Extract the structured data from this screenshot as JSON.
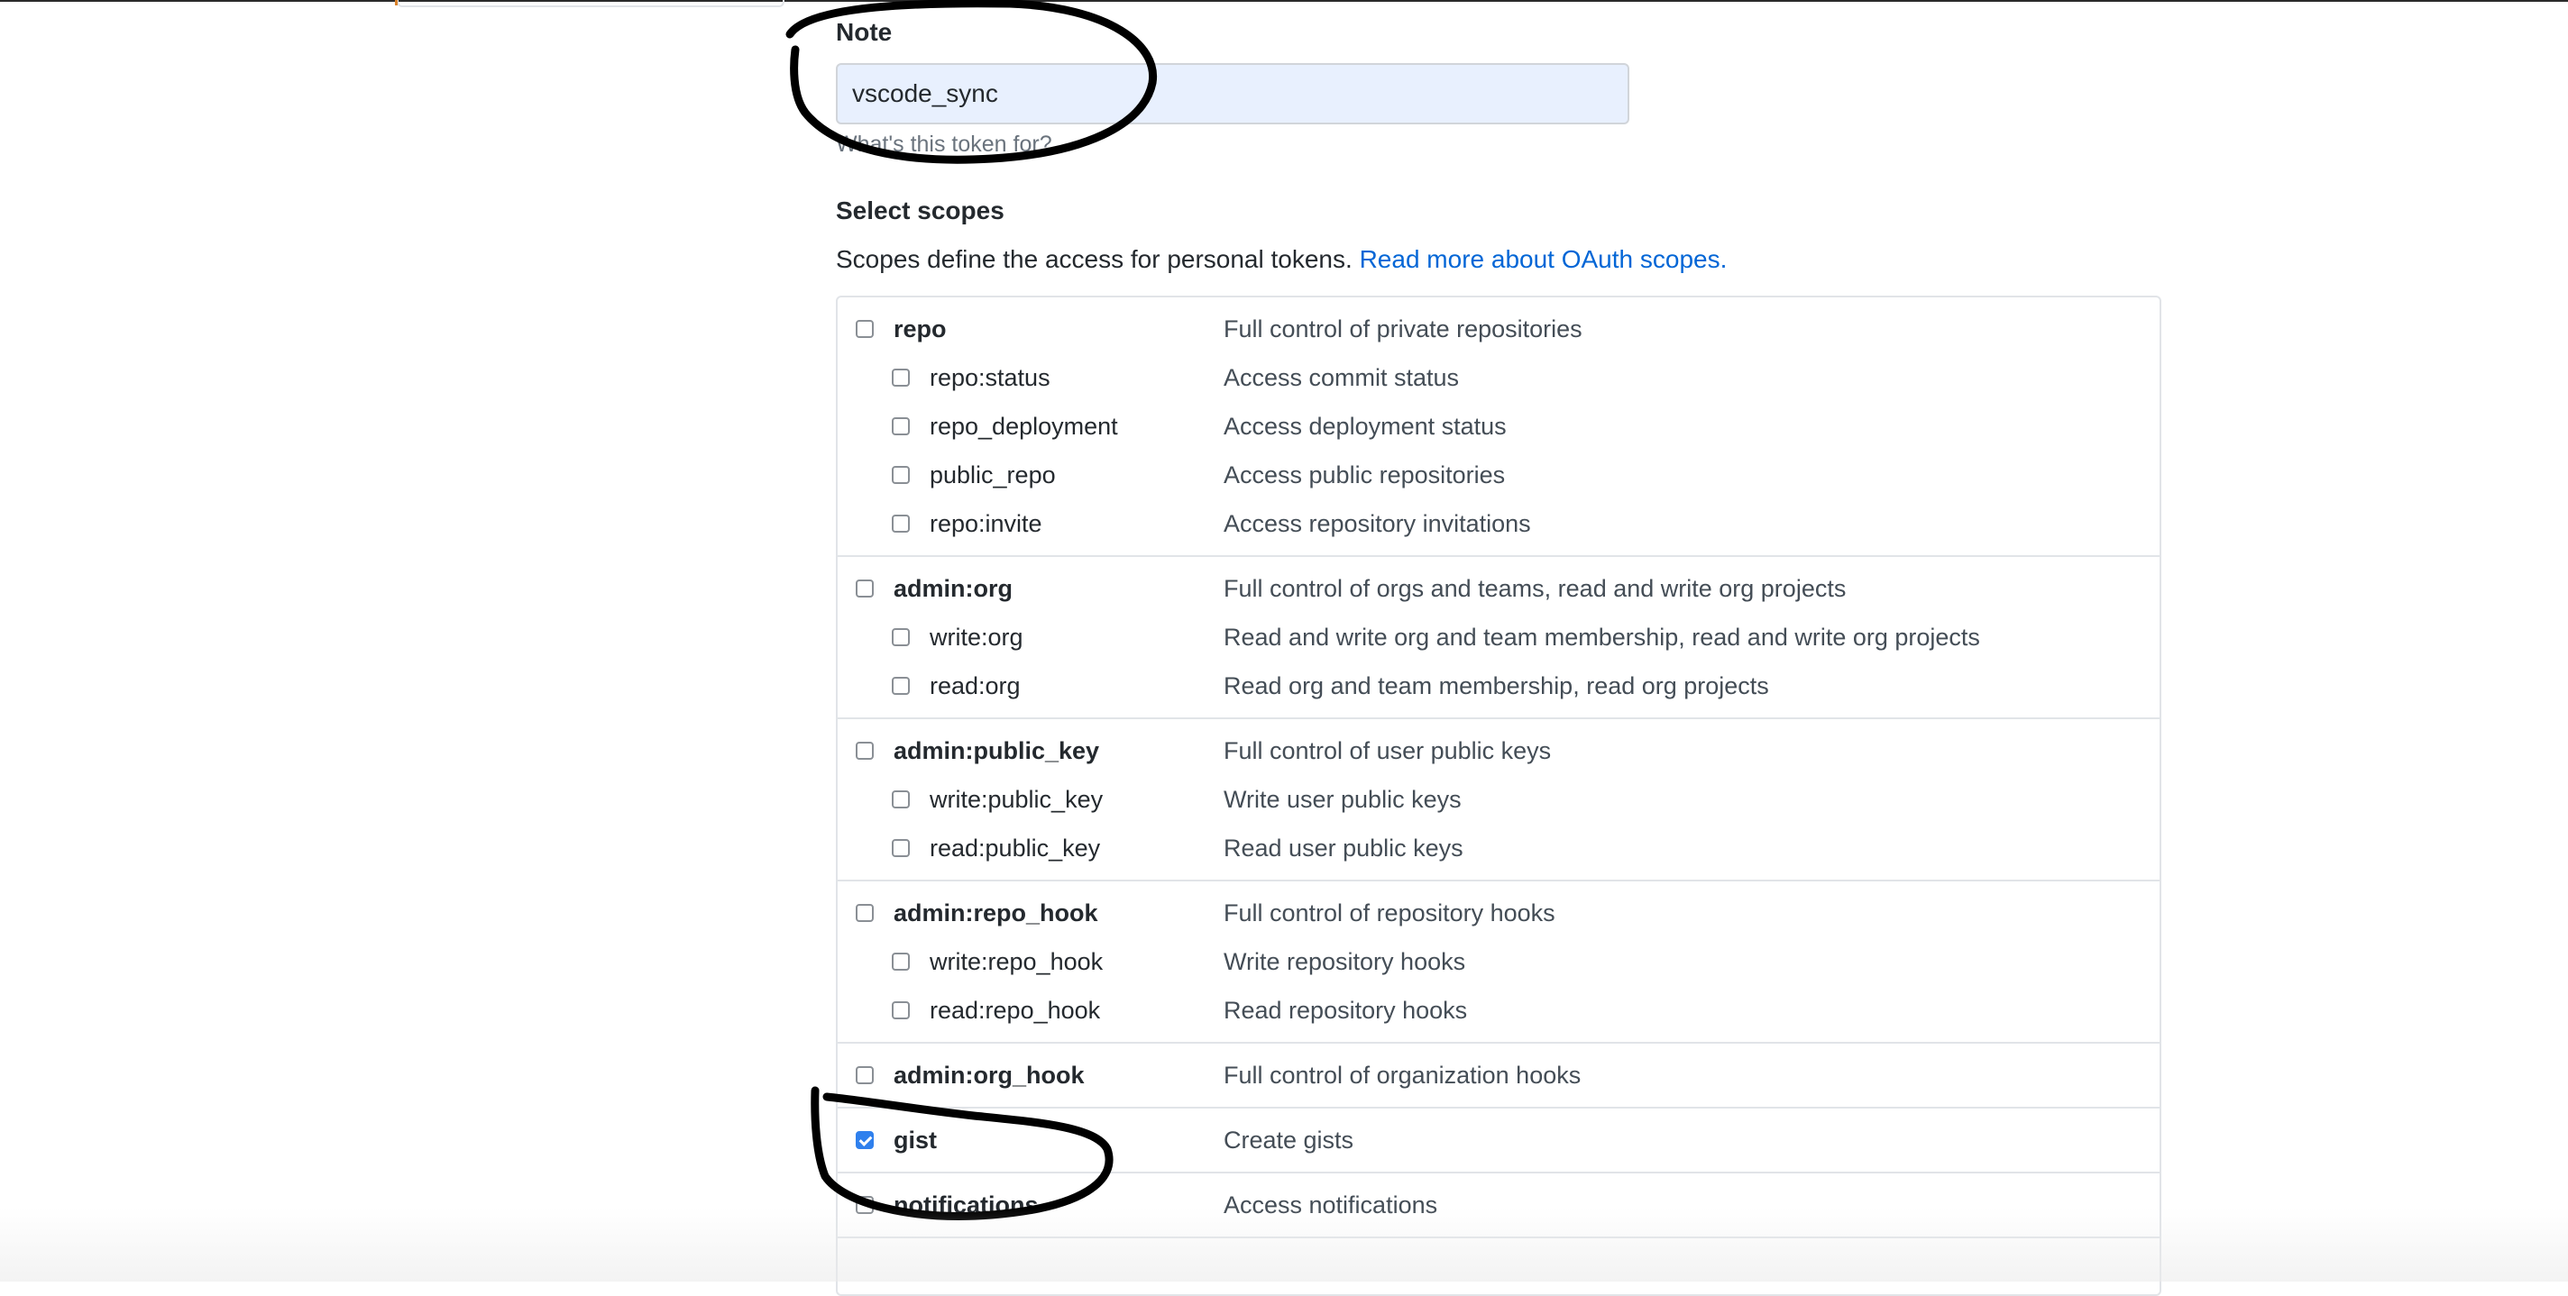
{
  "note": {
    "label": "Note",
    "value": "vscode_sync",
    "hint": "What's this token for?"
  },
  "scopes": {
    "title": "Select scopes",
    "description": "Scopes define the access for personal tokens.",
    "link": "Read more about OAuth scopes.",
    "groups": [
      {
        "name": "repo",
        "description": "Full control of private repositories",
        "checked": false,
        "children": [
          {
            "name": "repo:status",
            "description": "Access commit status",
            "checked": false
          },
          {
            "name": "repo_deployment",
            "description": "Access deployment status",
            "checked": false
          },
          {
            "name": "public_repo",
            "description": "Access public repositories",
            "checked": false
          },
          {
            "name": "repo:invite",
            "description": "Access repository invitations",
            "checked": false
          }
        ]
      },
      {
        "name": "admin:org",
        "description": "Full control of orgs and teams, read and write org projects",
        "checked": false,
        "children": [
          {
            "name": "write:org",
            "description": "Read and write org and team membership, read and write org projects",
            "checked": false
          },
          {
            "name": "read:org",
            "description": "Read org and team membership, read org projects",
            "checked": false
          }
        ]
      },
      {
        "name": "admin:public_key",
        "description": "Full control of user public keys",
        "checked": false,
        "children": [
          {
            "name": "write:public_key",
            "description": "Write user public keys",
            "checked": false
          },
          {
            "name": "read:public_key",
            "description": "Read user public keys",
            "checked": false
          }
        ]
      },
      {
        "name": "admin:repo_hook",
        "description": "Full control of repository hooks",
        "checked": false,
        "children": [
          {
            "name": "write:repo_hook",
            "description": "Write repository hooks",
            "checked": false
          },
          {
            "name": "read:repo_hook",
            "description": "Read repository hooks",
            "checked": false
          }
        ]
      },
      {
        "name": "admin:org_hook",
        "description": "Full control of organization hooks",
        "checked": false,
        "children": []
      },
      {
        "name": "gist",
        "description": "Create gists",
        "checked": true,
        "children": []
      },
      {
        "name": "notifications",
        "description": "Access notifications",
        "checked": false,
        "children": []
      }
    ]
  },
  "colors": {
    "link": "#0366d6",
    "checkbox_checked": "#2f80ed",
    "input_fill": "#e8f0fe",
    "annotation_ink": "#000000"
  }
}
